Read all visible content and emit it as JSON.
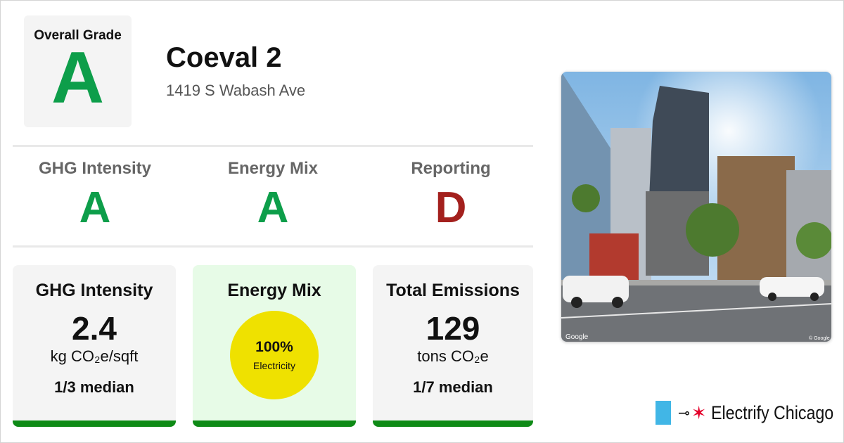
{
  "overall": {
    "label": "Overall Grade",
    "grade": "A",
    "grade_color": "#0d9e4a"
  },
  "building": {
    "name": "Coeval 2",
    "address": "1419 S Wabash Ave"
  },
  "grades": [
    {
      "title": "GHG Intensity",
      "grade": "A",
      "color": "#0d9e4a"
    },
    {
      "title": "Energy Mix",
      "grade": "A",
      "color": "#0d9e4a"
    },
    {
      "title": "Reporting",
      "grade": "D",
      "color": "#a3201d"
    }
  ],
  "cards": {
    "ghg": {
      "title": "GHG Intensity",
      "value": "2.4",
      "unit": "kg CO₂e/sqft",
      "median": "1/3 median"
    },
    "mix": {
      "title": "Energy Mix",
      "percent": "100%",
      "source": "Electricity"
    },
    "emissions": {
      "title": "Total Emissions",
      "value": "129",
      "unit": "tons CO₂e",
      "median": "1/7 median"
    }
  },
  "photo": {
    "credit_left": "Google",
    "credit_right": "© Google"
  },
  "brand": {
    "name": "Electrify Chicago",
    "star": "✶",
    "plug": "⊸",
    "flag_color": "#41b6e6",
    "star_color": "#e4002b"
  },
  "accent_bar_color": "#0e8a16"
}
